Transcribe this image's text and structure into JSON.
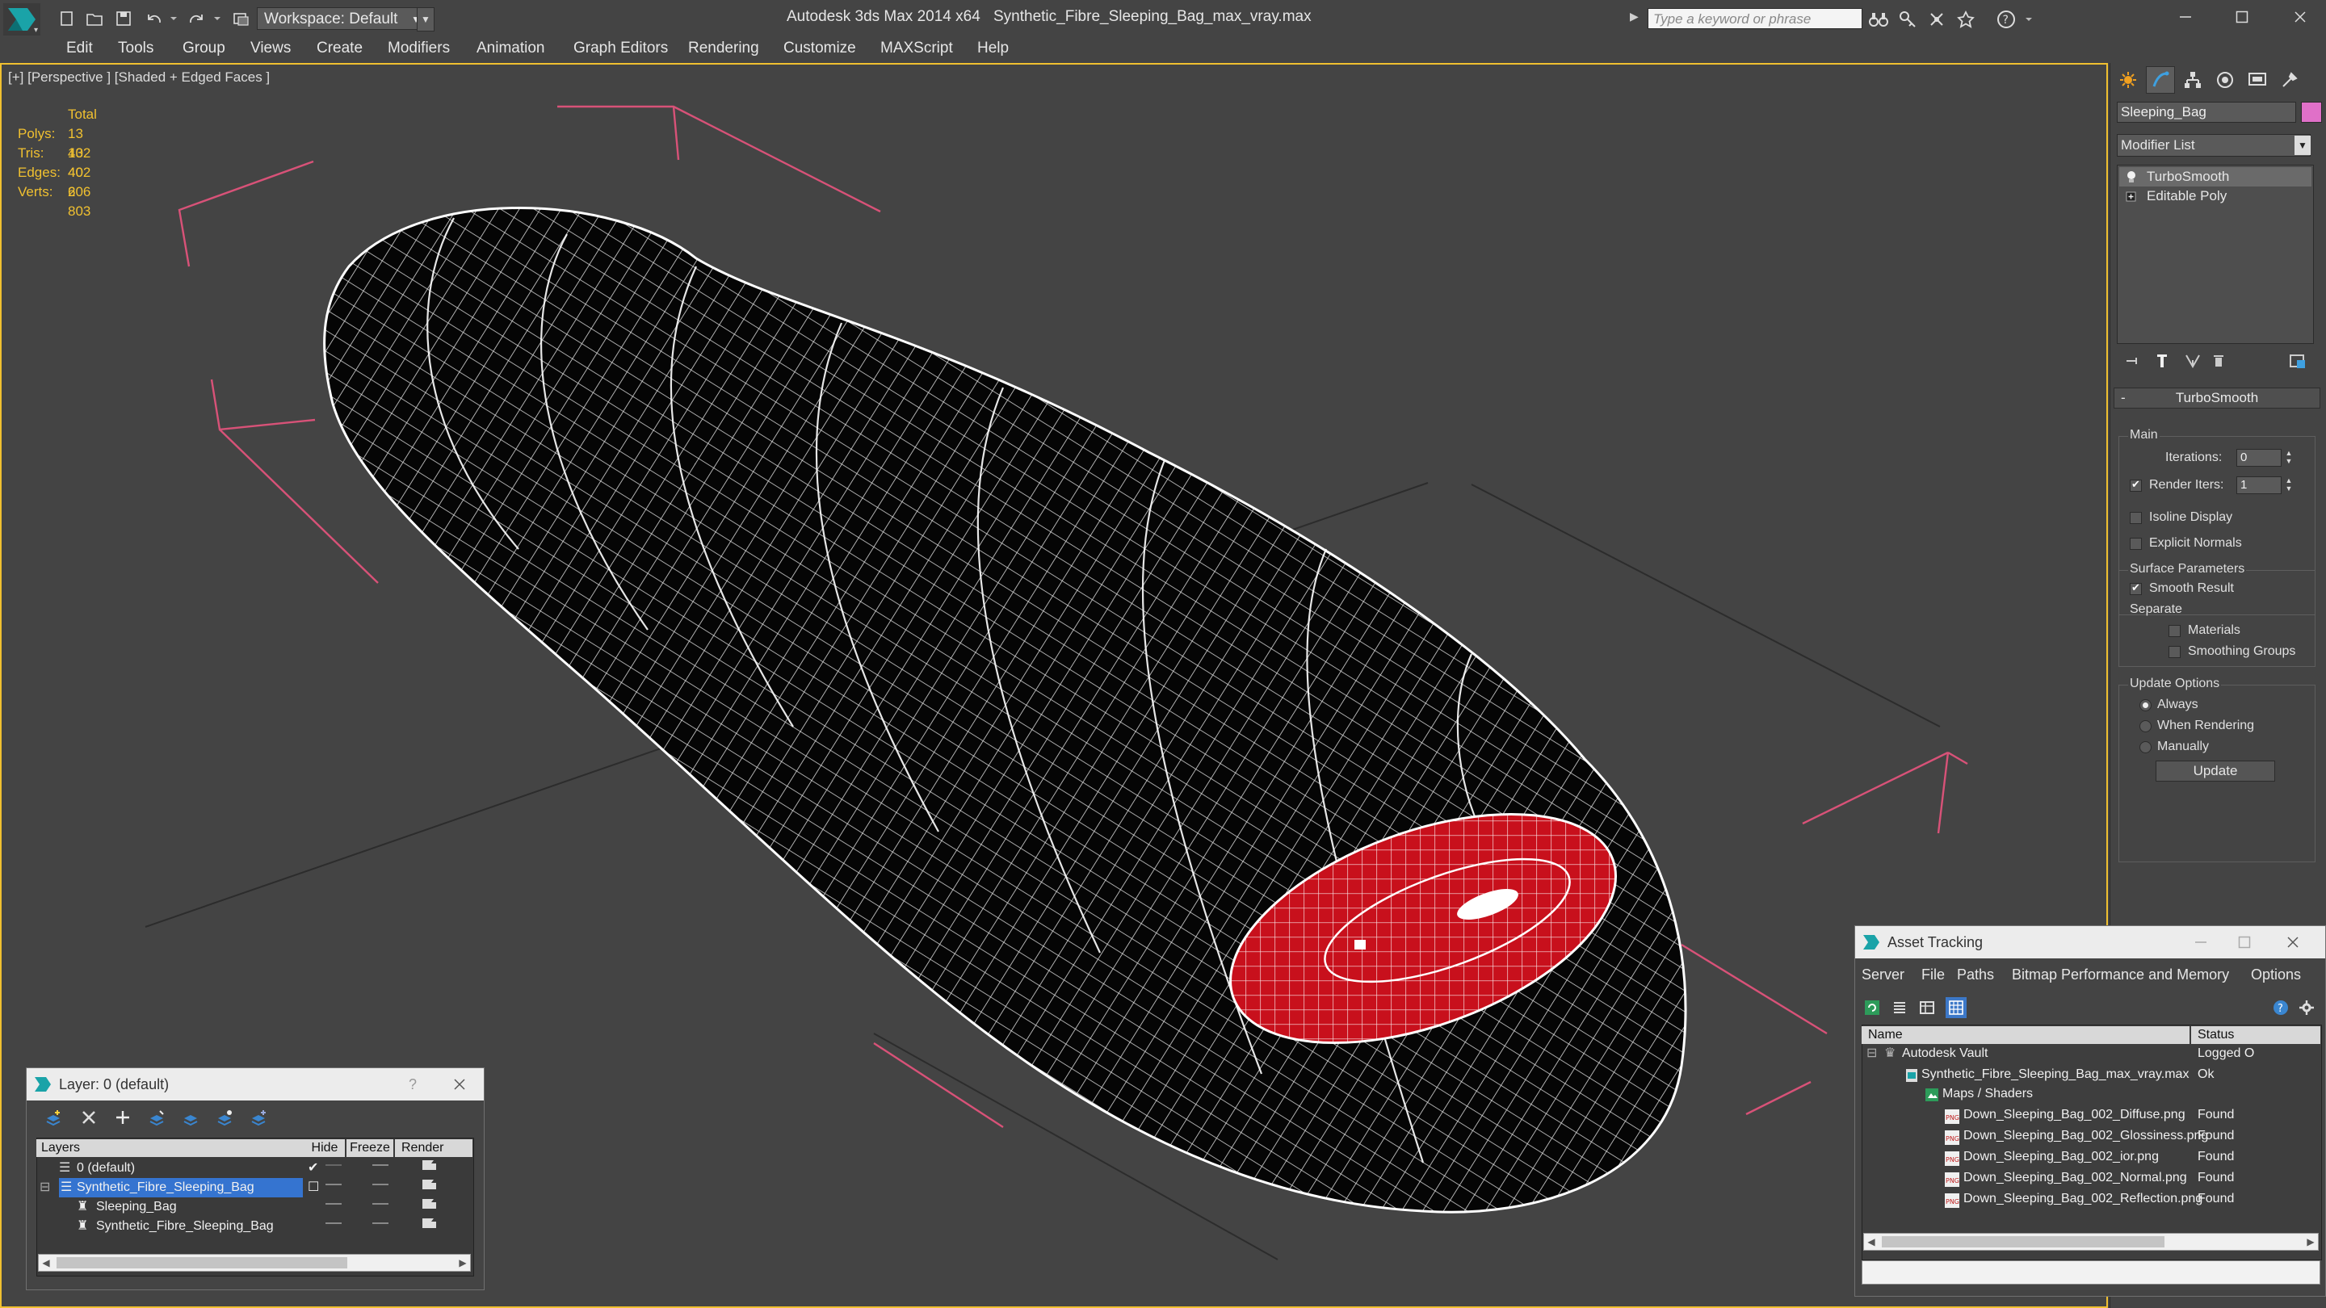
{
  "titlebar": {
    "workspace_label": "Workspace: Default",
    "app_title": "Autodesk 3ds Max  2014 x64",
    "file_title": "Synthetic_Fibre_Sleeping_Bag_max_vray.max",
    "search_placeholder": "Type a keyword or phrase"
  },
  "menubar": {
    "items": [
      "Edit",
      "Tools",
      "Group",
      "Views",
      "Create",
      "Modifiers",
      "Animation",
      "Graph Editors",
      "Rendering",
      "Customize",
      "MAXScript",
      "Help"
    ]
  },
  "viewport": {
    "label": "[+] [Perspective ] [Shaded + Edged Faces ]",
    "stats": {
      "header": "Total",
      "rows": [
        {
          "label": "Polys:",
          "value": "13 402"
        },
        {
          "label": "Tris:",
          "value": "13 402"
        },
        {
          "label": "Edges:",
          "value": "40 206"
        },
        {
          "label": "Verts:",
          "value": "6 803"
        }
      ]
    },
    "colors": {
      "bag_body": "#050505",
      "bag_wire": "#ffffff",
      "hood_fill": "#d4101e",
      "bounds": "#e0567c"
    }
  },
  "command_panel": {
    "object_name": "Sleeping_Bag",
    "object_color": "#e070c8",
    "modifier_list_label": "Modifier List",
    "stack": [
      "TurboSmooth",
      "Editable Poly"
    ],
    "rollout": {
      "title": "TurboSmooth",
      "main_label": "Main",
      "iterations_label": "Iterations:",
      "iterations_value": "0",
      "render_iters_label": "Render Iters:",
      "render_iters_value": "1",
      "isoline_label": "Isoline Display",
      "explicit_normals_label": "Explicit Normals",
      "surface_params_label": "Surface Parameters",
      "smooth_result_label": "Smooth Result",
      "separate_label": "Separate",
      "materials_label": "Materials",
      "smoothing_groups_label": "Smoothing Groups",
      "update_options_label": "Update Options",
      "always_label": "Always",
      "when_rendering_label": "When Rendering",
      "manually_label": "Manually",
      "update_button": "Update"
    }
  },
  "layer_window": {
    "title": "Layer: 0 (default)",
    "help": "?",
    "columns": {
      "layers": "Layers",
      "hide": "Hide",
      "freeze": "Freeze",
      "render": "Render"
    },
    "rows": [
      {
        "name": "0 (default)"
      },
      {
        "name": "Synthetic_Fibre_Sleeping_Bag"
      },
      {
        "name": "Sleeping_Bag"
      },
      {
        "name": "Synthetic_Fibre_Sleeping_Bag"
      }
    ]
  },
  "asset_window": {
    "title": "Asset Tracking",
    "menus": [
      "Server",
      "File",
      "Paths",
      "Bitmap Performance and Memory",
      "Options"
    ],
    "columns": {
      "name": "Name",
      "status": "Status"
    },
    "rows": [
      {
        "name": "Autodesk Vault",
        "status": "Logged O"
      },
      {
        "name": "Synthetic_Fibre_Sleeping_Bag_max_vray.max",
        "status": "Ok"
      },
      {
        "name": "Maps / Shaders",
        "status": ""
      },
      {
        "name": "Down_Sleeping_Bag_002_Diffuse.png",
        "status": "Found"
      },
      {
        "name": "Down_Sleeping_Bag_002_Glossiness.png",
        "status": "Found"
      },
      {
        "name": "Down_Sleeping_Bag_002_ior.png",
        "status": "Found"
      },
      {
        "name": "Down_Sleeping_Bag_002_Normal.png",
        "status": "Found"
      },
      {
        "name": "Down_Sleeping_Bag_002_Reflection.png",
        "status": "Found"
      }
    ]
  }
}
